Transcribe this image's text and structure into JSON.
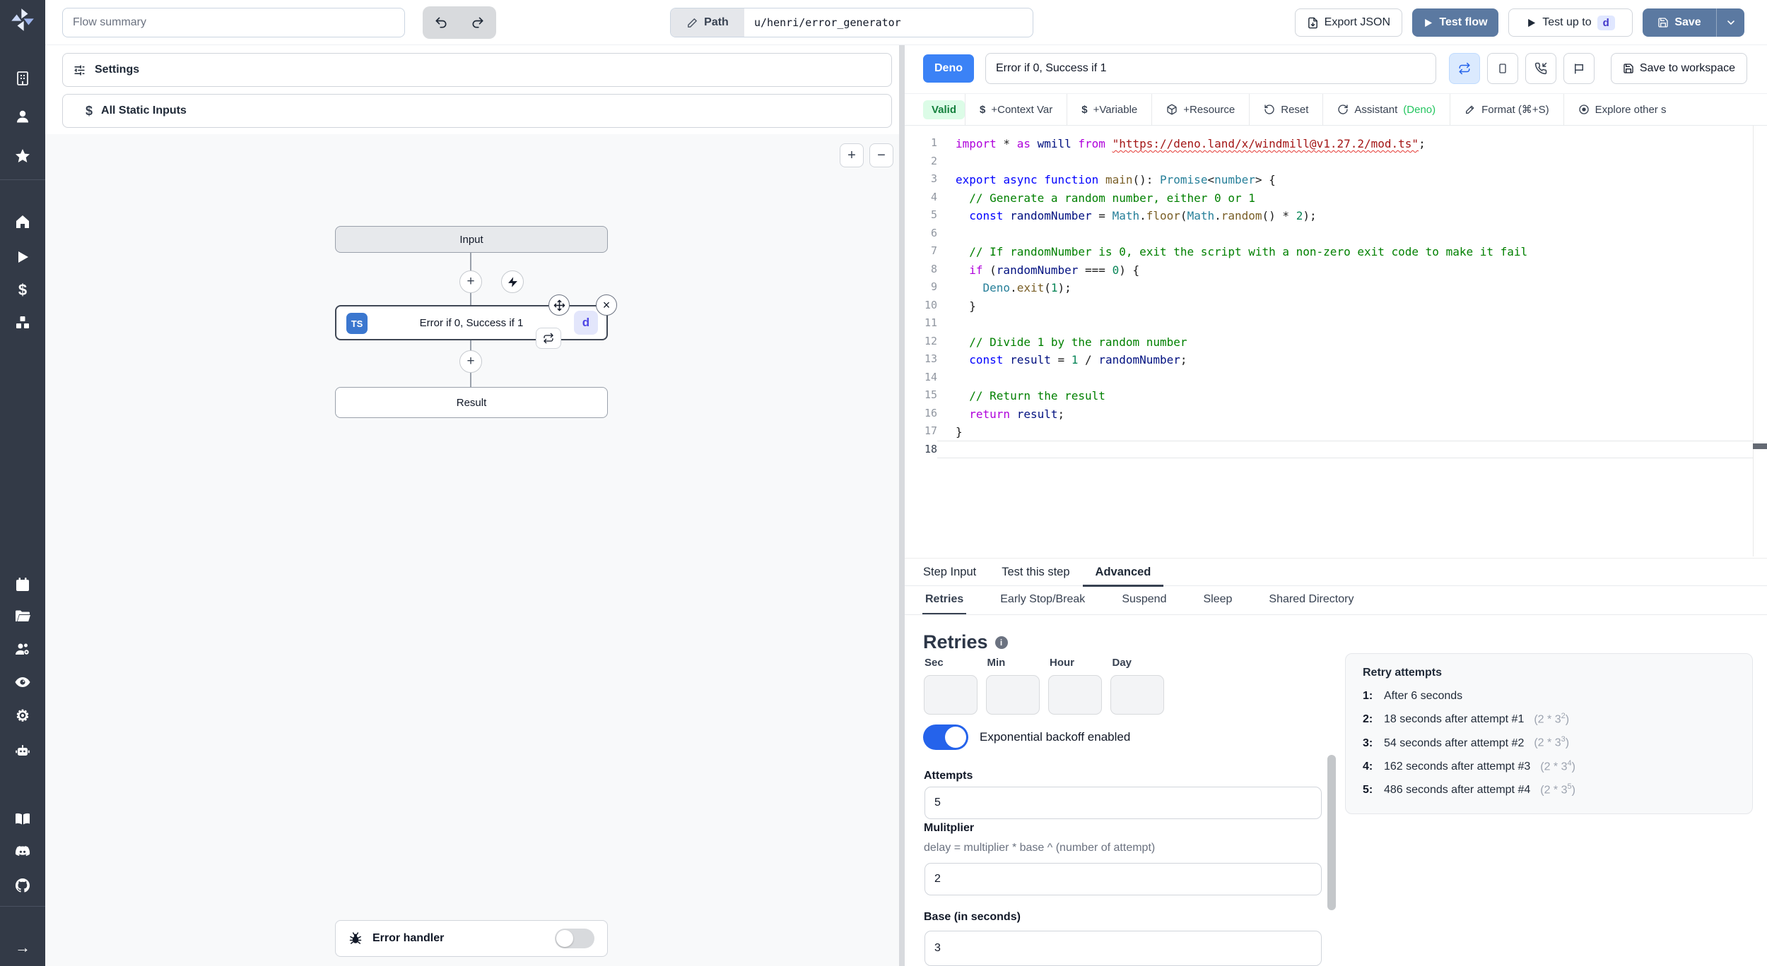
{
  "icons": {
    "plus": "+",
    "minus": "−",
    "dollar": "$",
    "gear": "⚙",
    "arrow_right": "→",
    "close": "×",
    "info": "i"
  },
  "topbar": {
    "flow_summary_placeholder": "Flow summary",
    "path_label": "Path",
    "path_value": "u/henri/error_generator",
    "export_json": "Export JSON",
    "test_flow": "Test flow",
    "test_up_to": "Test up to",
    "test_up_to_badge": "d",
    "save": "Save"
  },
  "left_panel": {
    "settings": "Settings",
    "all_static_inputs": "All Static Inputs",
    "graph": {
      "input_node": "Input",
      "step_lang_badge": "TS",
      "step_label": "Error if 0, Success if 1",
      "step_suffix_badge": "d",
      "result_node": "Result",
      "error_handler": "Error handler"
    }
  },
  "editor_header": {
    "lang_badge": "Deno",
    "step_name": "Error if 0, Success if 1",
    "save_to_workspace": "Save to workspace"
  },
  "editor_toolbar": {
    "valid": "Valid",
    "context_var": "+Context Var",
    "variable": "+Variable",
    "resource": "+Resource",
    "reset": "Reset",
    "assistant": "Assistant ",
    "assistant_lang": "(Deno)",
    "format": "Format (⌘+S)",
    "explore": "Explore other s"
  },
  "code": {
    "active_line": 18,
    "lines": [
      [
        [
          "kc",
          "import"
        ],
        [
          "pl",
          " * "
        ],
        [
          "kc",
          "as"
        ],
        [
          "vr",
          " wmill"
        ],
        [
          "pl",
          " "
        ],
        [
          "kc",
          "from"
        ],
        [
          "pl",
          " "
        ],
        [
          "sq",
          "\"https://deno.land/x/windmill@v1.27.2/mod.ts\""
        ],
        [
          "pl",
          ";"
        ]
      ],
      [],
      [
        [
          "kw",
          "export"
        ],
        [
          "pl",
          " "
        ],
        [
          "kw",
          "async"
        ],
        [
          "pl",
          " "
        ],
        [
          "kw",
          "function"
        ],
        [
          "pl",
          " "
        ],
        [
          "fn",
          "main"
        ],
        [
          "pl",
          "(): "
        ],
        [
          "cl",
          "Promise"
        ],
        [
          "pl",
          "<"
        ],
        [
          "cl",
          "number"
        ],
        [
          "pl",
          "> {"
        ]
      ],
      [
        [
          "pl",
          "  "
        ],
        [
          "cm",
          "// Generate a random number, either 0 or 1"
        ]
      ],
      [
        [
          "pl",
          "  "
        ],
        [
          "kw",
          "const"
        ],
        [
          "vr",
          " randomNumber"
        ],
        [
          "pl",
          " = "
        ],
        [
          "cl",
          "Math"
        ],
        [
          "pl",
          "."
        ],
        [
          "fn",
          "floor"
        ],
        [
          "pl",
          "("
        ],
        [
          "cl",
          "Math"
        ],
        [
          "pl",
          "."
        ],
        [
          "fn",
          "random"
        ],
        [
          "pl",
          "() * "
        ],
        [
          "nm",
          "2"
        ],
        [
          "pl",
          ");"
        ]
      ],
      [],
      [
        [
          "pl",
          "  "
        ],
        [
          "cm",
          "// If randomNumber is 0, exit the script with a non-zero exit code to make it fail"
        ]
      ],
      [
        [
          "pl",
          "  "
        ],
        [
          "kc",
          "if"
        ],
        [
          "pl",
          " ("
        ],
        [
          "vr",
          "randomNumber"
        ],
        [
          "pl",
          " === "
        ],
        [
          "nm",
          "0"
        ],
        [
          "pl",
          ") {"
        ]
      ],
      [
        [
          "pl",
          "    "
        ],
        [
          "cl",
          "Deno"
        ],
        [
          "pl",
          "."
        ],
        [
          "fn",
          "exit"
        ],
        [
          "pl",
          "("
        ],
        [
          "nm",
          "1"
        ],
        [
          "pl",
          ");"
        ]
      ],
      [
        [
          "pl",
          "  }"
        ]
      ],
      [],
      [
        [
          "pl",
          "  "
        ],
        [
          "cm",
          "// Divide 1 by the random number"
        ]
      ],
      [
        [
          "pl",
          "  "
        ],
        [
          "kw",
          "const"
        ],
        [
          "vr",
          " result"
        ],
        [
          "pl",
          " = "
        ],
        [
          "nm",
          "1"
        ],
        [
          "pl",
          " / "
        ],
        [
          "vr",
          "randomNumber"
        ],
        [
          "pl",
          ";"
        ]
      ],
      [],
      [
        [
          "pl",
          "  "
        ],
        [
          "cm",
          "// Return the result"
        ]
      ],
      [
        [
          "pl",
          "  "
        ],
        [
          "kc",
          "return"
        ],
        [
          "vr",
          " result"
        ],
        [
          "pl",
          ";"
        ]
      ],
      [
        [
          "pl",
          "}"
        ]
      ],
      []
    ]
  },
  "panel_tabs": {
    "tabs": [
      "Step Input",
      "Test this step",
      "Advanced"
    ],
    "active": "Advanced"
  },
  "retry_tabs": [
    "Retries",
    "Early Stop/Break",
    "Suspend",
    "Sleep",
    "Shared Directory"
  ],
  "retries": {
    "title": "Retries",
    "constant_labels": [
      "Sec",
      "Min",
      "Hour",
      "Day"
    ],
    "exponential_label": "Exponential backoff enabled",
    "attempts_label": "Attempts",
    "attempts_value": "5",
    "multiplier_label": "Mulitplier",
    "multiplier_help": "delay = multiplier * base ^ (number of attempt)",
    "multiplier_value": "2",
    "base_label": "Base (in seconds)",
    "base_value": "3",
    "preview": {
      "title": "Retry attempts",
      "rows": [
        {
          "n": "1:",
          "t": "After 6 seconds",
          "fb": null,
          "fs": null
        },
        {
          "n": "2:",
          "t": "18 seconds after attempt #1",
          "fb": "(2 * 3",
          "fs": "2"
        },
        {
          "n": "3:",
          "t": "54 seconds after attempt #2",
          "fb": "(2 * 3",
          "fs": "3"
        },
        {
          "n": "4:",
          "t": "162 seconds after attempt #3",
          "fb": "(2 * 3",
          "fs": "4"
        },
        {
          "n": "5:",
          "t": "486 seconds after attempt #4",
          "fb": "(2 * 3",
          "fs": "5"
        }
      ]
    }
  },
  "colors": {
    "primary_button": "#5b79a1",
    "deno_badge": "#3b82f6",
    "valid_bg": "#dcfce7",
    "valid_text": "#15803d",
    "toggle_on": "#2563eb",
    "sidebar_bg": "#333a47"
  }
}
